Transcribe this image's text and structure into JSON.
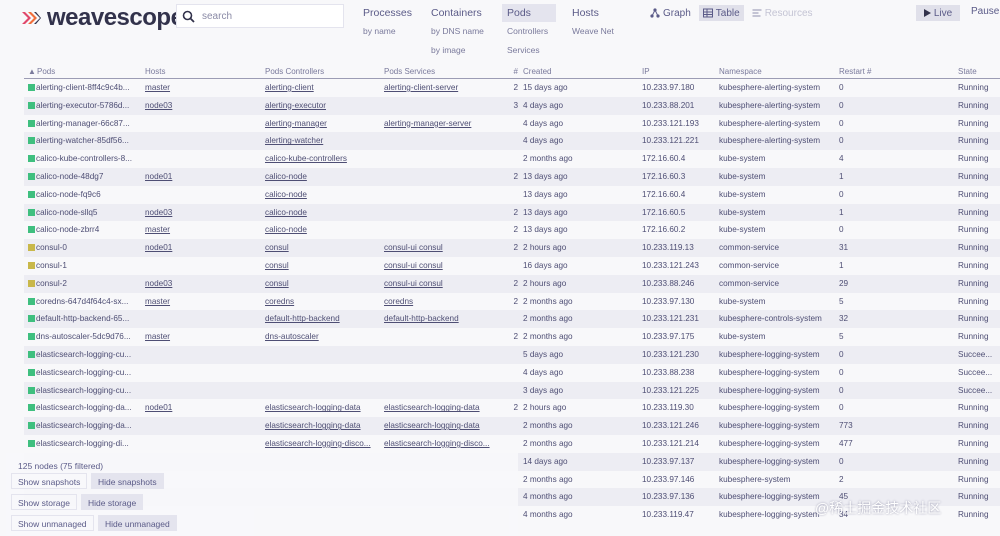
{
  "app": {
    "name": "weavescope"
  },
  "search": {
    "placeholder": "search"
  },
  "topologies": [
    {
      "label": "Processes",
      "subs": [
        "by name"
      ],
      "active": false
    },
    {
      "label": "Containers",
      "subs": [
        "by DNS name",
        "by image"
      ],
      "active": false
    },
    {
      "label": "Pods",
      "subs": [
        "Controllers",
        "Services"
      ],
      "active": true
    },
    {
      "label": "Hosts",
      "subs": [
        "Weave Net"
      ],
      "active": false
    }
  ],
  "views": {
    "graph": "Graph",
    "table": "Table",
    "resources": "Resources"
  },
  "controls": {
    "live": "Live",
    "pause": "Pause"
  },
  "table": {
    "headers": [
      "Pods",
      "Hosts",
      "Pods Controllers",
      "Pods Services",
      "#",
      "Created",
      "IP",
      "Namespace",
      "Restart #",
      "State"
    ],
    "rows": [
      {
        "name": "alerting-client-8ff4c9c4b...",
        "host": "master",
        "ctrl": "alerting-client",
        "svc": "alerting-client-server",
        "count": "2",
        "created": "15 days ago",
        "ip": "10.233.97.180",
        "ns": "kubesphere-alerting-system",
        "restart": "0",
        "state": "Running",
        "color": "#3fbf7f"
      },
      {
        "name": "alerting-executor-5786d...",
        "host": "node03",
        "ctrl": "alerting-executor",
        "svc": "",
        "count": "3",
        "created": "4 days ago",
        "ip": "10.233.88.201",
        "ns": "kubesphere-alerting-system",
        "restart": "0",
        "state": "Running",
        "color": "#3fbf7f"
      },
      {
        "name": "alerting-manager-66c87...",
        "host": "",
        "ctrl": "alerting-manager",
        "svc": "alerting-manager-server",
        "count": "",
        "created": "4 days ago",
        "ip": "10.233.121.193",
        "ns": "kubesphere-alerting-system",
        "restart": "0",
        "state": "Running",
        "color": "#3fbf7f"
      },
      {
        "name": "alerting-watcher-85df56...",
        "host": "",
        "ctrl": "alerting-watcher",
        "svc": "",
        "count": "",
        "created": "4 days ago",
        "ip": "10.233.121.221",
        "ns": "kubesphere-alerting-system",
        "restart": "0",
        "state": "Running",
        "color": "#3fbf7f"
      },
      {
        "name": "calico-kube-controllers-8...",
        "host": "",
        "ctrl": "calico-kube-controllers",
        "svc": "",
        "count": "",
        "created": "2 months ago",
        "ip": "172.16.60.4",
        "ns": "kube-system",
        "restart": "4",
        "state": "Running",
        "color": "#3fbf7f"
      },
      {
        "name": "calico-node-48dg7",
        "host": "node01",
        "ctrl": "calico-node",
        "svc": "",
        "count": "2",
        "created": "13 days ago",
        "ip": "172.16.60.3",
        "ns": "kube-system",
        "restart": "1",
        "state": "Running",
        "color": "#3fbf7f"
      },
      {
        "name": "calico-node-fq9c6",
        "host": "",
        "ctrl": "calico-node",
        "svc": "",
        "count": "",
        "created": "13 days ago",
        "ip": "172.16.60.4",
        "ns": "kube-system",
        "restart": "0",
        "state": "Running",
        "color": "#3fbf7f"
      },
      {
        "name": "calico-node-sllq5",
        "host": "node03",
        "ctrl": "calico-node",
        "svc": "",
        "count": "2",
        "created": "13 days ago",
        "ip": "172.16.60.5",
        "ns": "kube-system",
        "restart": "1",
        "state": "Running",
        "color": "#3fbf7f"
      },
      {
        "name": "calico-node-zbrr4",
        "host": "master",
        "ctrl": "calico-node",
        "svc": "",
        "count": "2",
        "created": "13 days ago",
        "ip": "172.16.60.2",
        "ns": "kube-system",
        "restart": "0",
        "state": "Running",
        "color": "#3fbf7f"
      },
      {
        "name": "consul-0",
        "host": "node01",
        "ctrl": "consul",
        "svc": "consul-ui consul",
        "count": "2",
        "created": "2 hours ago",
        "ip": "10.233.119.13",
        "ns": "common-service",
        "restart": "31",
        "state": "Running",
        "color": "#c9b84a"
      },
      {
        "name": "consul-1",
        "host": "",
        "ctrl": "consul",
        "svc": "consul-ui consul",
        "count": "",
        "created": "16 days ago",
        "ip": "10.233.121.243",
        "ns": "common-service",
        "restart": "1",
        "state": "Running",
        "color": "#c9b84a"
      },
      {
        "name": "consul-2",
        "host": "node03",
        "ctrl": "consul",
        "svc": "consul-ui consul",
        "count": "2",
        "created": "2 hours ago",
        "ip": "10.233.88.246",
        "ns": "common-service",
        "restart": "29",
        "state": "Running",
        "color": "#c9b84a"
      },
      {
        "name": "coredns-647d4f64c4-sx...",
        "host": "master",
        "ctrl": "coredns",
        "svc": "coredns",
        "count": "2",
        "created": "2 months ago",
        "ip": "10.233.97.130",
        "ns": "kube-system",
        "restart": "5",
        "state": "Running",
        "color": "#3fbf7f"
      },
      {
        "name": "default-http-backend-65...",
        "host": "",
        "ctrl": "default-http-backend",
        "svc": "default-http-backend",
        "count": "",
        "created": "2 months ago",
        "ip": "10.233.121.231",
        "ns": "kubesphere-controls-system",
        "restart": "32",
        "state": "Running",
        "color": "#3fbf7f"
      },
      {
        "name": "dns-autoscaler-5dc9d76...",
        "host": "master",
        "ctrl": "dns-autoscaler",
        "svc": "",
        "count": "2",
        "created": "2 months ago",
        "ip": "10.233.97.175",
        "ns": "kube-system",
        "restart": "5",
        "state": "Running",
        "color": "#3fbf7f"
      },
      {
        "name": "elasticsearch-logging-cu...",
        "host": "",
        "ctrl": "",
        "svc": "",
        "count": "",
        "created": "5 days ago",
        "ip": "10.233.121.230",
        "ns": "kubesphere-logging-system",
        "restart": "0",
        "state": "Succee...",
        "color": "#3fbf7f"
      },
      {
        "name": "elasticsearch-logging-cu...",
        "host": "",
        "ctrl": "",
        "svc": "",
        "count": "",
        "created": "4 days ago",
        "ip": "10.233.88.238",
        "ns": "kubesphere-logging-system",
        "restart": "0",
        "state": "Succee...",
        "color": "#3fbf7f"
      },
      {
        "name": "elasticsearch-logging-cu...",
        "host": "",
        "ctrl": "",
        "svc": "",
        "count": "",
        "created": "3 days ago",
        "ip": "10.233.121.225",
        "ns": "kubesphere-logging-system",
        "restart": "0",
        "state": "Succee...",
        "color": "#3fbf7f"
      },
      {
        "name": "elasticsearch-logging-da...",
        "host": "node01",
        "ctrl": "elasticsearch-logging-data",
        "svc": "elasticsearch-logging-data",
        "count": "2",
        "created": "2 hours ago",
        "ip": "10.233.119.30",
        "ns": "kubesphere-logging-system",
        "restart": "0",
        "state": "Running",
        "color": "#3fbf7f"
      },
      {
        "name": "elasticsearch-logging-da...",
        "host": "",
        "ctrl": "elasticsearch-logging-data",
        "svc": "elasticsearch-logging-data",
        "count": "",
        "created": "2 months ago",
        "ip": "10.233.121.246",
        "ns": "kubesphere-logging-system",
        "restart": "773",
        "state": "Running",
        "color": "#3fbf7f"
      },
      {
        "name": "elasticsearch-logging-di...",
        "host": "",
        "ctrl": "elasticsearch-logging-disco...",
        "svc": "elasticsearch-logging-disco...",
        "count": "",
        "created": "2 months ago",
        "ip": "10.233.121.214",
        "ns": "kubesphere-logging-system",
        "restart": "477",
        "state": "Running",
        "color": "#3fbf7f"
      },
      {
        "name": "",
        "host": "",
        "ctrl": "",
        "svc": "",
        "count": "",
        "created": "14 days ago",
        "ip": "10.233.97.137",
        "ns": "kubesphere-logging-system",
        "restart": "0",
        "state": "Running",
        "color": ""
      },
      {
        "name": "",
        "host": "",
        "ctrl": "",
        "svc": "",
        "count": "",
        "created": "2 months ago",
        "ip": "10.233.97.146",
        "ns": "kubesphere-system",
        "restart": "2",
        "state": "Running",
        "color": ""
      },
      {
        "name": "",
        "host": "",
        "ctrl": "",
        "svc": "",
        "count": "",
        "created": "4 months ago",
        "ip": "10.233.97.136",
        "ns": "kubesphere-logging-system",
        "restart": "45",
        "state": "Running",
        "color": ""
      },
      {
        "name": "",
        "host": "",
        "ctrl": "",
        "svc": "",
        "count": "",
        "created": "4 months ago",
        "ip": "10.233.119.47",
        "ns": "kubesphere-logging-system",
        "restart": "34",
        "state": "Running",
        "color": ""
      }
    ]
  },
  "status": {
    "nodes": "125 nodes (75 filtered)",
    "show_snapshots": "Show snapshots",
    "hide_snapshots": "Hide snapshots",
    "show_storage": "Show storage",
    "hide_storage": "Hide storage",
    "show_unmanaged": "Show unmanaged",
    "hide_unmanaged": "Hide unmanaged"
  },
  "watermark": "@稀土掘金技术社区"
}
